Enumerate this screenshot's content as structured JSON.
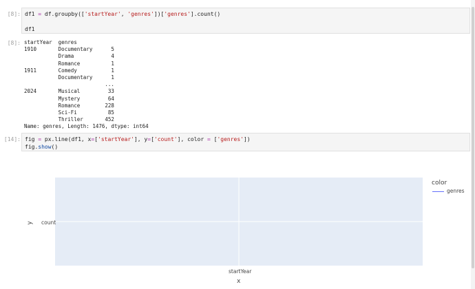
{
  "cells": [
    {
      "prompt": "[8]:",
      "code_line1_pre": "df1 ",
      "code_line1_eq": "=",
      "code_line1_mid": " df.groupby([",
      "code_line1_s1": "'startYear'",
      "code_line1_sep": ", ",
      "code_line1_s2": "'genres'",
      "code_line1_mid2": "])[",
      "code_line1_s3": "'genres'",
      "code_line1_end": "].count()",
      "code_line2": "df1"
    },
    {
      "prompt": "[8]:",
      "output_text": "startYear  genres\n1910       Documentary      5\n           Drama            4\n           Romance          1\n1911       Comedy           1\n           Documentary      1\n                          ...\n2024       Musical         33\n           Mystery         64\n           Romance        228\n           Sci-Fi          85\n           Thriller       452\nName: genres, Length: 1476, dtype: int64"
    },
    {
      "prompt": "[14]:",
      "code_line1_pre": "fig ",
      "code_line1_eq": "=",
      "code_line1_mid": " px.line(df1, x",
      "code_line1_eq2": "=",
      "code_line1_b1": "[",
      "code_line1_s1": "'startYear'",
      "code_line1_mid2": "], y",
      "code_line1_eq3": "=",
      "code_line1_b2": "[",
      "code_line1_s2": "'count'",
      "code_line1_mid3": "], color ",
      "code_line1_eq4": "=",
      "code_line1_b3": " [",
      "code_line1_s3": "'genres'",
      "code_line1_end": "])",
      "code_line2_pre": "fig.",
      "code_line2_fn": "show",
      "code_line2_end": "()"
    }
  ],
  "chart_data": {
    "type": "line",
    "x_tick_label": "startYear",
    "xlabel": "x",
    "y_tick_label": "count",
    "ylabel": "y",
    "legend_title": "color",
    "series": [
      {
        "name": "genres",
        "values": []
      }
    ],
    "grid": true,
    "legend_placement": "top-right",
    "colors": {
      "plot_bg": "#e5ecf6",
      "series": "#636efa"
    }
  }
}
